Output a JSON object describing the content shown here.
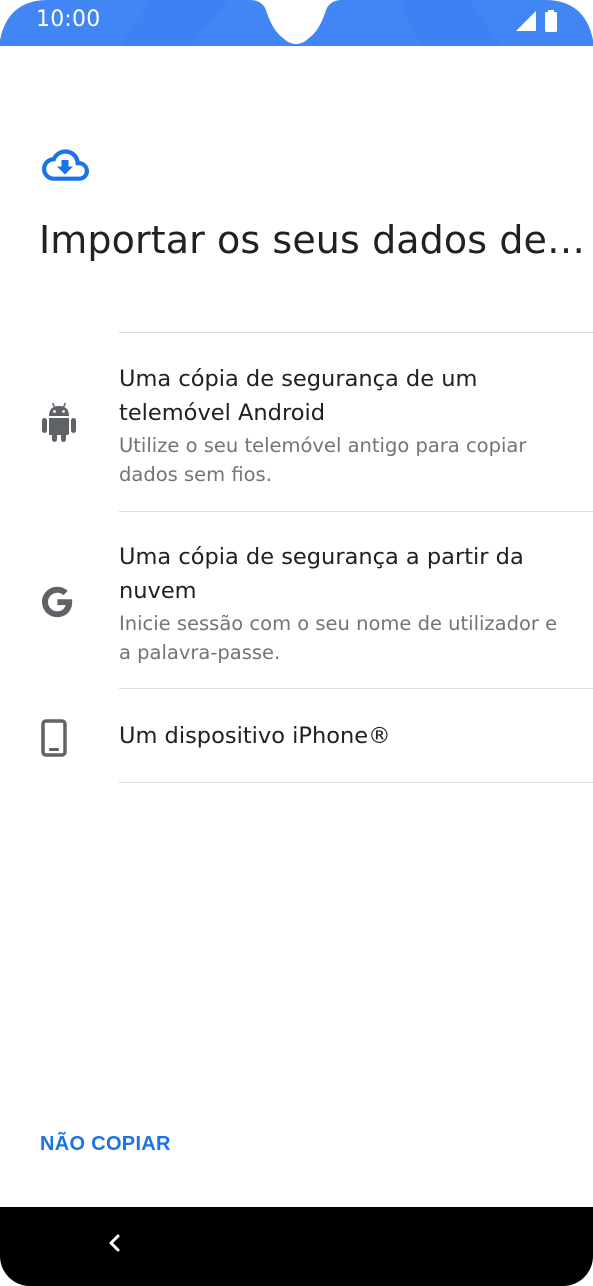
{
  "status_bar": {
    "time": "10:00",
    "icons": [
      "signal-icon",
      "battery-icon"
    ]
  },
  "header": {
    "icon": "cloud-download-icon",
    "title": "Importar os seus dados de…"
  },
  "options": [
    {
      "icon": "android-icon",
      "title": "Uma cópia de segurança de um telemóvel Android",
      "description": "Utilize o seu telemóvel antigo para copiar dados sem fios."
    },
    {
      "icon": "google-icon",
      "title": "Uma cópia de segurança a partir da nuvem",
      "description": "Inicie sessão com o seu nome de utilizador e a palavra-passe."
    },
    {
      "icon": "phone-icon",
      "title": "Um dispositivo iPhone®",
      "description": ""
    }
  ],
  "footer": {
    "skip_label": "NÃO COPIAR"
  },
  "nav_bar": {
    "back_icon": "back-chevron-icon"
  },
  "colors": {
    "accent": "#1a73e8",
    "status_bar": "#4285f4",
    "title_text": "#202124",
    "secondary_text": "#70757a",
    "icon_gray": "#5f6368",
    "divider": "#dadce0"
  }
}
